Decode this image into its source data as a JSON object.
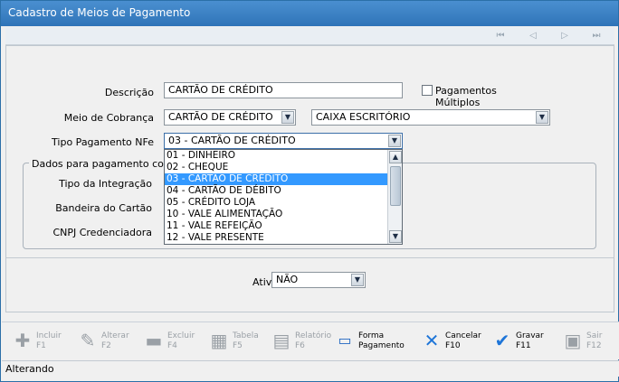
{
  "window": {
    "title": "Cadastro de Meios de Pagamento"
  },
  "nav": {
    "first": "first-icon",
    "prev": "prev-icon",
    "next": "next-icon",
    "last": "last-icon"
  },
  "form": {
    "descricao_label": "Descrição",
    "descricao_value": "CARTÃO DE CRÉDITO",
    "pagamentos_multiplos_label": "Pagamentos Múltiplos",
    "meio_cobranca_label": "Meio de Cobrança",
    "meio_cobranca_value": "CARTÃO DE CRÉDITO",
    "caixa_value": "CAIXA ESCRITÓRIO",
    "tipo_pagamento_label": "Tipo Pagamento NFe",
    "tipo_pagamento_value": "03 - CARTÃO DE CRÉDITO",
    "group_title": "Dados para pagamento com c",
    "tipo_integracao_label": "Tipo da Integração",
    "bandeira_label": "Bandeira do Cartão",
    "cnpj_label": "CNPJ Credenciadora",
    "ativo_label": "Ativo",
    "ativo_value": "NÃO"
  },
  "dropdown": {
    "items": [
      "01 - DINHEIRO",
      "02 - CHEQUE",
      "03 - CARTÃO DE CRÉDITO",
      "04 - CARTÃO DE DÉBITO",
      "05 - CRÉDITO LOJA",
      "10 - VALE ALIMENTAÇÃO",
      "11 - VALE REFEIÇÃO",
      "12 - VALE PRESENTE"
    ],
    "selected_index": 2
  },
  "toolbar": {
    "incluir": {
      "label": "Incluir",
      "key": "F1"
    },
    "alterar": {
      "label": "Alterar",
      "key": "F2"
    },
    "excluir": {
      "label": "Excluir",
      "key": "F4"
    },
    "tabela": {
      "label": "Tabela",
      "key": "F5"
    },
    "relatorio": {
      "label": "Relatório",
      "key": "F6"
    },
    "forma": {
      "label": "Forma",
      "key": "Pagamento"
    },
    "cancelar": {
      "label": "Cancelar",
      "key": "F10"
    },
    "gravar": {
      "label": "Gravar",
      "key": "F11"
    },
    "sair": {
      "label": "Sair",
      "key": "F12"
    }
  },
  "status": {
    "text": "Alterando"
  }
}
